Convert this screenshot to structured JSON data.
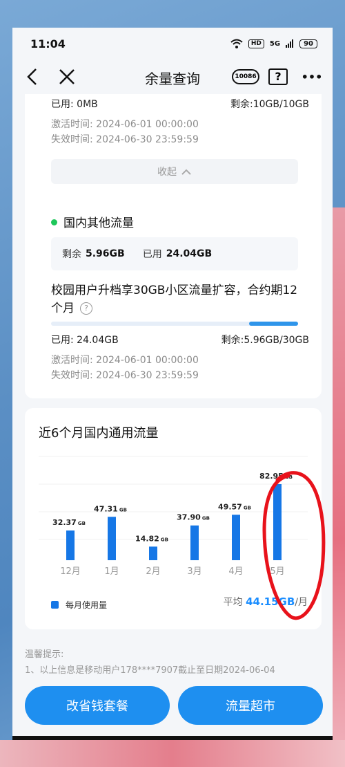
{
  "status_bar": {
    "time": "11:04",
    "hd": "HD",
    "signal": "5G",
    "battery": "90"
  },
  "nav": {
    "title": "余量查询",
    "service_label": "10086",
    "help_label": "?",
    "more_label": "•••"
  },
  "upper_plan": {
    "used": "已用: 0MB",
    "remaining": "剩余:10GB/10GB",
    "activate": "激活时间: 2024-06-01 00:00:00",
    "expire": "失效时间: 2024-06-30 23:59:59",
    "collapse_label": "收起"
  },
  "domestic_other": {
    "title": "国内其他流量",
    "remaining_label": "剩余",
    "remaining_value": "5.96GB",
    "used_label": "已用",
    "used_value": "24.04GB",
    "plan_name": "校园用户升档享30GB小区流量扩容，合约期12个月",
    "usage_fraction": 0.199,
    "used": "已用: 24.04GB",
    "remaining": "剩余:5.96GB/30GB",
    "activate": "激活时间: 2024-06-01 00:00:00",
    "expire": "失效时间: 2024-06-30 23:59:59"
  },
  "chart_section": {
    "title": "近6个月国内通用流量",
    "legend": "每月使用量",
    "avg_label": "平均",
    "avg_value": "44.15GB",
    "avg_unit": "/月"
  },
  "chart_data": {
    "type": "bar",
    "categories": [
      "12月",
      "1月",
      "2月",
      "3月",
      "4月",
      "5月"
    ],
    "values": [
      32.37,
      47.31,
      14.82,
      37.9,
      49.57,
      82.95
    ],
    "value_labels": [
      "32.37",
      "47.31",
      "14.82",
      "37.90",
      "49.57",
      "82.95"
    ],
    "unit": "GB",
    "color": "#1677e6"
  },
  "tips": {
    "title": "温馨提示:",
    "line1": "1、以上信息是移动用户178****7907截止至日期2024-06-04"
  },
  "buttons": {
    "left": "改省钱套餐",
    "right": "流量超市"
  },
  "colors": {
    "accent": "#1e8ff0",
    "annotation": "#e8121b"
  }
}
